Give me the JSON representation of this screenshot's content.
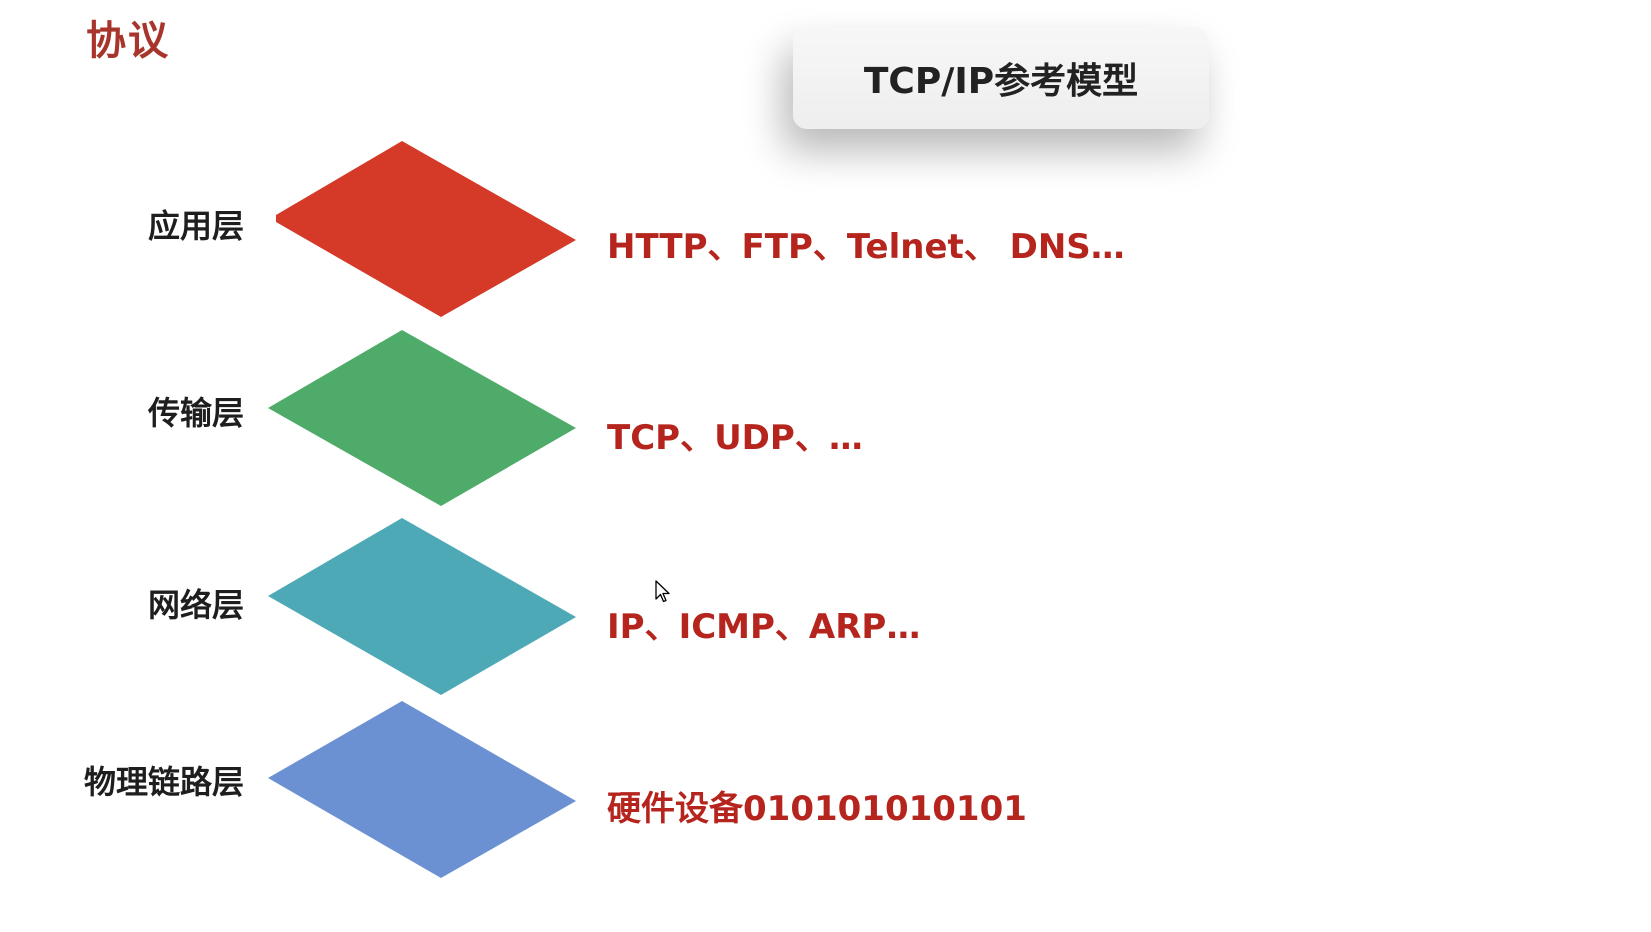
{
  "page_title": "协议",
  "model_card": {
    "title": "TCP/IP参考模型"
  },
  "layers": [
    {
      "label": "应用层",
      "protocols": "HTTP、FTP、Telnet、 DNS…",
      "color": "#d43a27"
    },
    {
      "label": "传输层",
      "protocols": "TCP、UDP、…",
      "color": "#4fab69"
    },
    {
      "label": "网络层",
      "protocols": "IP、ICMP、ARP…",
      "color": "#4ea9b6"
    },
    {
      "label": "物理链路层",
      "protocols": "硬件设备010101010101",
      "color": "#6b91d3"
    }
  ],
  "colors": {
    "title_accent": "#a8352c",
    "protocol_text": "#b5251d"
  }
}
